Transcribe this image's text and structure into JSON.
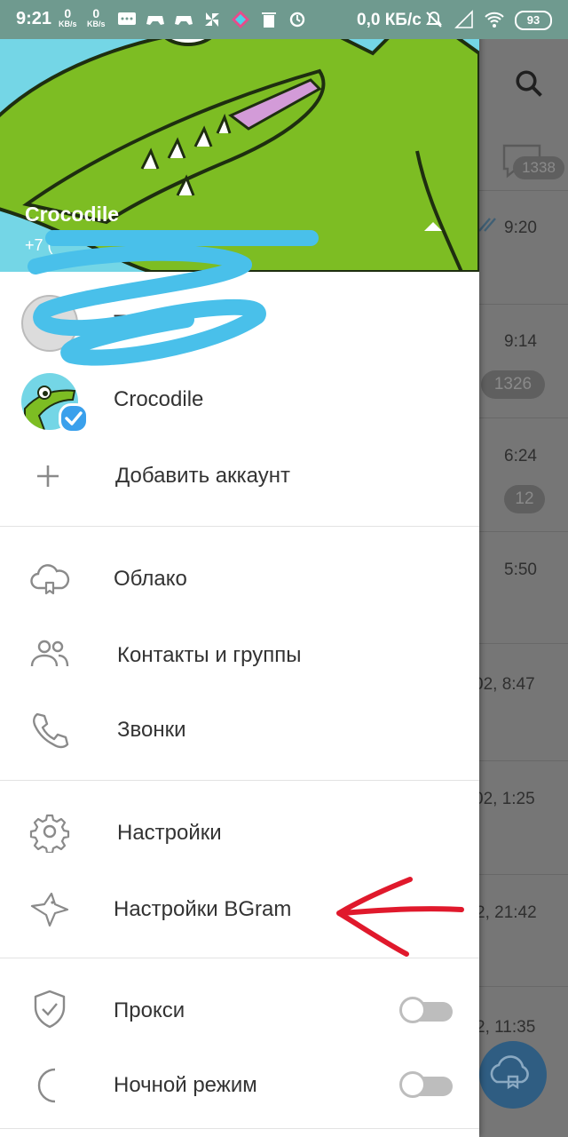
{
  "status_bar": {
    "time": "9:21",
    "net1": {
      "value": "0",
      "unit": "KB/s"
    },
    "net2": {
      "value": "0",
      "unit": "KB/s"
    },
    "speed": "0,0 КБ/с",
    "battery": "93",
    "icons": [
      "message-icon",
      "gamepad-icon",
      "gamepad-icon",
      "pinwheel-icon",
      "app-icon",
      "trash-icon",
      "refresh-icon",
      "mute-icon",
      "signal-icon",
      "wifi-icon",
      "battery-icon"
    ]
  },
  "drawer": {
    "header": {
      "name": "Crocodile",
      "phone": "+7 (",
      "expand_icon": "triangle-up-icon"
    },
    "accounts": [
      {
        "label": "Тарас"
      },
      {
        "label": "Crocodile",
        "verified_icon": "check-icon"
      }
    ],
    "add_account": {
      "label": "Добавить аккаунт",
      "icon": "plus-icon"
    },
    "menu": [
      {
        "label": "Облако",
        "icon": "cloud-icon"
      },
      {
        "label": "Контакты и группы",
        "icon": "people-icon"
      },
      {
        "label": "Звонки",
        "icon": "phone-icon"
      },
      {
        "label": "Настройки",
        "icon": "gear-icon"
      },
      {
        "label": "Настройки BGram",
        "icon": "bird-icon"
      },
      {
        "label": "Прокси",
        "icon": "shield-icon",
        "toggle": false
      },
      {
        "label": "Ночной режим",
        "icon": "moon-icon",
        "toggle": false
      }
    ]
  },
  "chat_list": {
    "search_icon": "search-icon",
    "proxy_badge": "1338",
    "items": [
      {
        "time": "9:20"
      },
      {
        "time": "9:14",
        "badge": "1326"
      },
      {
        "time": "6:24",
        "badge": "12"
      },
      {
        "time": "5:50"
      },
      {
        "time": "02, 8:47"
      },
      {
        "time": "02, 1:25"
      },
      {
        "time": "2, 21:42"
      },
      {
        "time": "2, 11:35"
      }
    ]
  },
  "colors": {
    "accent": "#3aa0ec",
    "header_bg": "#74d6e6",
    "annotation": "#e0192c",
    "scribble": "#49c0ea"
  }
}
